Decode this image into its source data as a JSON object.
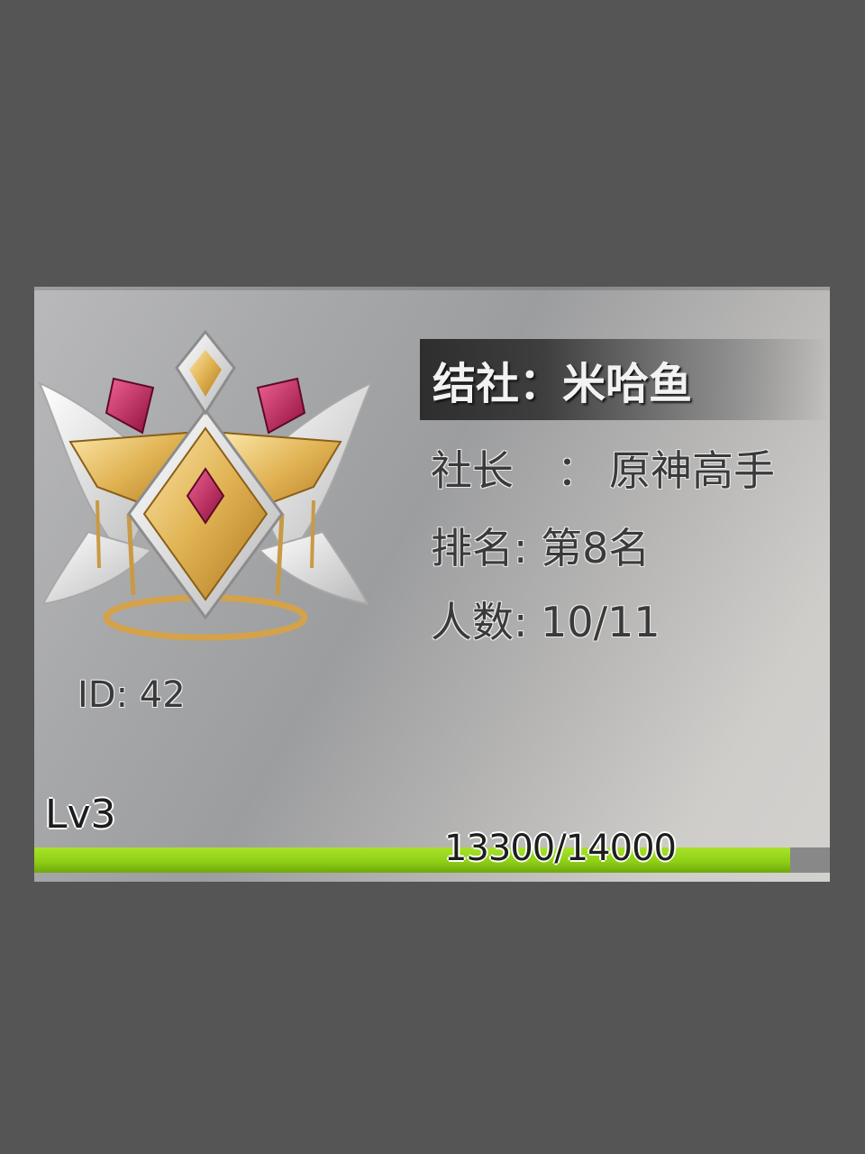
{
  "guild": {
    "title_label": "结社：",
    "name": "米哈鱼",
    "leader_label": "社长",
    "leader_colon": "：",
    "leader_name": "原神高手",
    "rank_label": "排名: ",
    "rank_value": "第8名",
    "members_label": "人数: ",
    "members_value": "10/11",
    "id_label": "ID: ",
    "id_value": "42",
    "level": "Lv3",
    "exp_text": "13300/14000",
    "exp_fraction": 0.95,
    "emblem_icon": "winged-crest-emblem-icon"
  },
  "colors": {
    "exp_bar": "#8fd016",
    "gem": "#c2185b",
    "gold": "#e0b252"
  }
}
